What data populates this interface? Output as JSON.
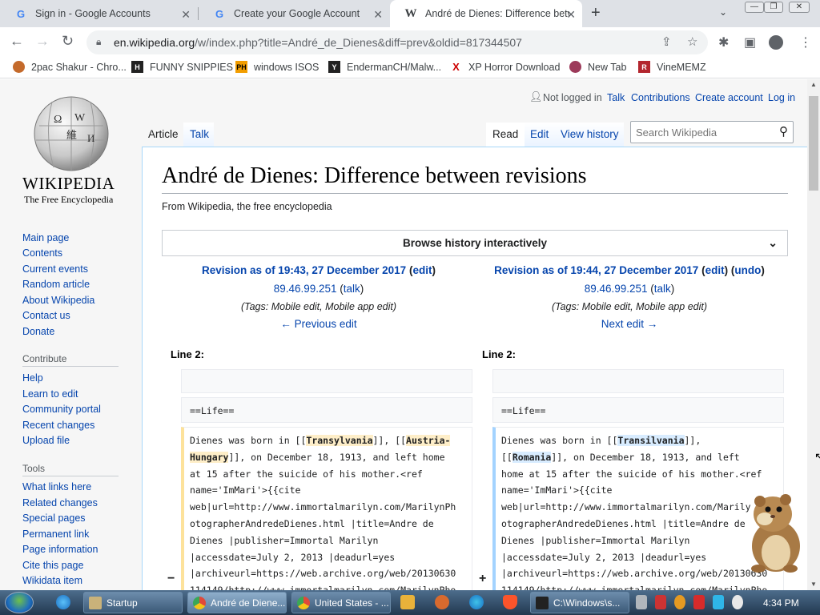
{
  "browser": {
    "tabs": [
      {
        "title": "Sign in - Google Accounts",
        "icon": "google-g-icon",
        "active": false
      },
      {
        "title": "Create your Google Account",
        "icon": "google-g-icon",
        "active": false
      },
      {
        "title": "André de Dienes: Difference betw",
        "icon": "wikipedia-w-icon",
        "active": true
      }
    ],
    "url_host": "en.wikipedia.org",
    "url_path": "/w/index.php?title=André_de_Dienes&diff=prev&oldid=817344507",
    "bookmarks": [
      {
        "label": "2pac Shakur - Chro...",
        "color": "#c46a2b",
        "glyph": ""
      },
      {
        "label": "FUNNY SNIPPIES",
        "color": "#222222",
        "glyph": "H"
      },
      {
        "label": "windows ISOS",
        "color": "#f29d00",
        "glyph": "PH"
      },
      {
        "label": "EndermanCH/Malw...",
        "color": "#222222",
        "glyph": "Y"
      },
      {
        "label": "XP Horror Download",
        "color": "#cc0000",
        "glyph": "X"
      },
      {
        "label": "New Tab",
        "color": "#9c3a5a",
        "glyph": ""
      },
      {
        "label": "VineMEMZ",
        "color": "#b3262e",
        "glyph": "R"
      }
    ]
  },
  "wiki": {
    "logo_word": "WIKIPEDIA",
    "logo_tagline": "The Free Encyclopedia",
    "nav_main": [
      "Main page",
      "Contents",
      "Current events",
      "Random article",
      "About Wikipedia",
      "Contact us",
      "Donate"
    ],
    "contribute_heading": "Contribute",
    "nav_contribute": [
      "Help",
      "Learn to edit",
      "Community portal",
      "Recent changes",
      "Upload file"
    ],
    "tools_heading": "Tools",
    "nav_tools": [
      "What links here",
      "Related changes",
      "Special pages",
      "Permanent link",
      "Page information",
      "Cite this page",
      "Wikidata item"
    ],
    "personal": {
      "not_logged": "Not logged in",
      "talk": "Talk",
      "contributions": "Contributions",
      "create": "Create account",
      "login": "Log in"
    },
    "tabs_left": {
      "article": "Article",
      "talk": "Talk"
    },
    "tabs_right": {
      "read": "Read",
      "edit": "Edit",
      "history": "View history"
    },
    "search_placeholder": "Search Wikipedia",
    "title": "André de Dienes: Difference between revisions",
    "subtitle": "From Wikipedia, the free encyclopedia",
    "browse": "Browse history interactively",
    "old_rev": {
      "heading": "Revision as of 19:43, 27 December 2017",
      "edit": "edit",
      "user": "89.46.99.251",
      "talk": "talk",
      "tags": "(Tags: Mobile edit, Mobile app edit)",
      "nav": "← Previous edit"
    },
    "new_rev": {
      "heading": "Revision as of 19:44, 27 December 2017",
      "edit": "edit",
      "undo": "undo",
      "user": "89.46.99.251",
      "talk": "talk",
      "tags": "(Tags: Mobile edit, Mobile app edit)",
      "nav": "Next edit →"
    },
    "line_left": "Line 2:",
    "line_right": "Line 2:",
    "ctx": "==Life==",
    "old_text": {
      "pre": "Dienes was born in [[",
      "hl1": "Transylvania",
      "mid": "]], [[",
      "hl2": "Austria-\nHungary",
      "post": "]], on December 18, 1913, and left home\nat 15 after the suicide of his mother.<ref\nname='ImMari'>{{cite\nweb|url=http://www.immortalmarilyn.com/MarilynPh\notographerAndredeDienes.html |title=Andre de\nDienes |publisher=Immortal Marilyn\n|accessdate=July 2, 2013 |deadurl=yes\n|archiveurl=https://web.archive.org/web/20130630\n114149/http://www.immortalmarilyn.com/MarilynPho"
    },
    "new_text": {
      "pre": "Dienes was born in [[",
      "hl1": "Transilvania",
      "mid": "]],\n[[",
      "hl2": "Romania",
      "post": "]], on December 18, 1913, and left\nhome at 15 after the suicide of his mother.<ref\nname='ImMari'>{{cite\nweb|url=http://www.immortalmarilyn.com/Marily\notographerAndredeDienes.html |title=Andre de\nDienes |publisher=Immortal Marilyn\n|accessdate=July 2, 2013 |deadurl=yes\n|archiveurl=https://web.archive.org/web/20130630\n114149/http://www.immortalmarilyn.com/MarilynPho"
    },
    "minus": "−",
    "plus": "+"
  },
  "taskbar": {
    "items": [
      {
        "label": "Startup",
        "color": "#c9b27a"
      },
      {
        "label": "André de Diene...",
        "color": "#e0493a"
      },
      {
        "label": "United States - ...",
        "color": "#e0493a"
      },
      {
        "label": "C:\\Windows\\s...",
        "color": "#222222"
      }
    ],
    "clock": "4:34 PM"
  }
}
